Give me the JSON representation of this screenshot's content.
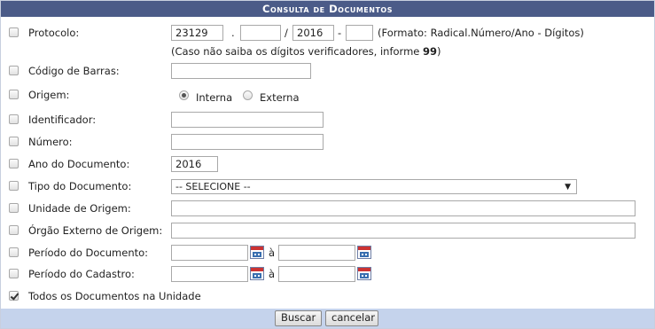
{
  "header": {
    "title": "Consulta de Documentos"
  },
  "protocolo": {
    "label": "Protocolo:",
    "radical": "23129",
    "dot": ".",
    "numero": "",
    "slash": "/",
    "ano": "2016",
    "dash": "-",
    "digitos": "",
    "formato": "(Formato: Radical.Número/Ano - Dígitos)",
    "hint_prefix": "(Caso não saiba os dígitos verificadores, informe ",
    "hint_value": "99",
    "hint_suffix": ")"
  },
  "codigo_barras": {
    "label": "Código de Barras:",
    "value": ""
  },
  "origem": {
    "label": "Origem:",
    "option_interna": "Interna",
    "option_externa": "Externa",
    "selected": "Interna"
  },
  "identificador": {
    "label": "Identificador:",
    "value": ""
  },
  "numero": {
    "label": "Número:",
    "value": ""
  },
  "ano_documento": {
    "label": "Ano do Documento:",
    "value": "2016"
  },
  "tipo_documento": {
    "label": "Tipo do Documento:",
    "selected": "-- SELECIONE --"
  },
  "unidade_origem": {
    "label": "Unidade de Origem:",
    "value": ""
  },
  "orgao_externo": {
    "label": "Órgão Externo de Origem:",
    "value": ""
  },
  "periodo_documento": {
    "label": "Período do Documento:",
    "de": "",
    "a_label": "à",
    "ate": ""
  },
  "periodo_cadastro": {
    "label": "Período do Cadastro:",
    "de": "",
    "a_label": "à",
    "ate": ""
  },
  "todos_documentos": {
    "label": "Todos os Documentos na Unidade",
    "checked": true
  },
  "buttons": {
    "buscar": "Buscar",
    "cancelar": "cancelar"
  }
}
